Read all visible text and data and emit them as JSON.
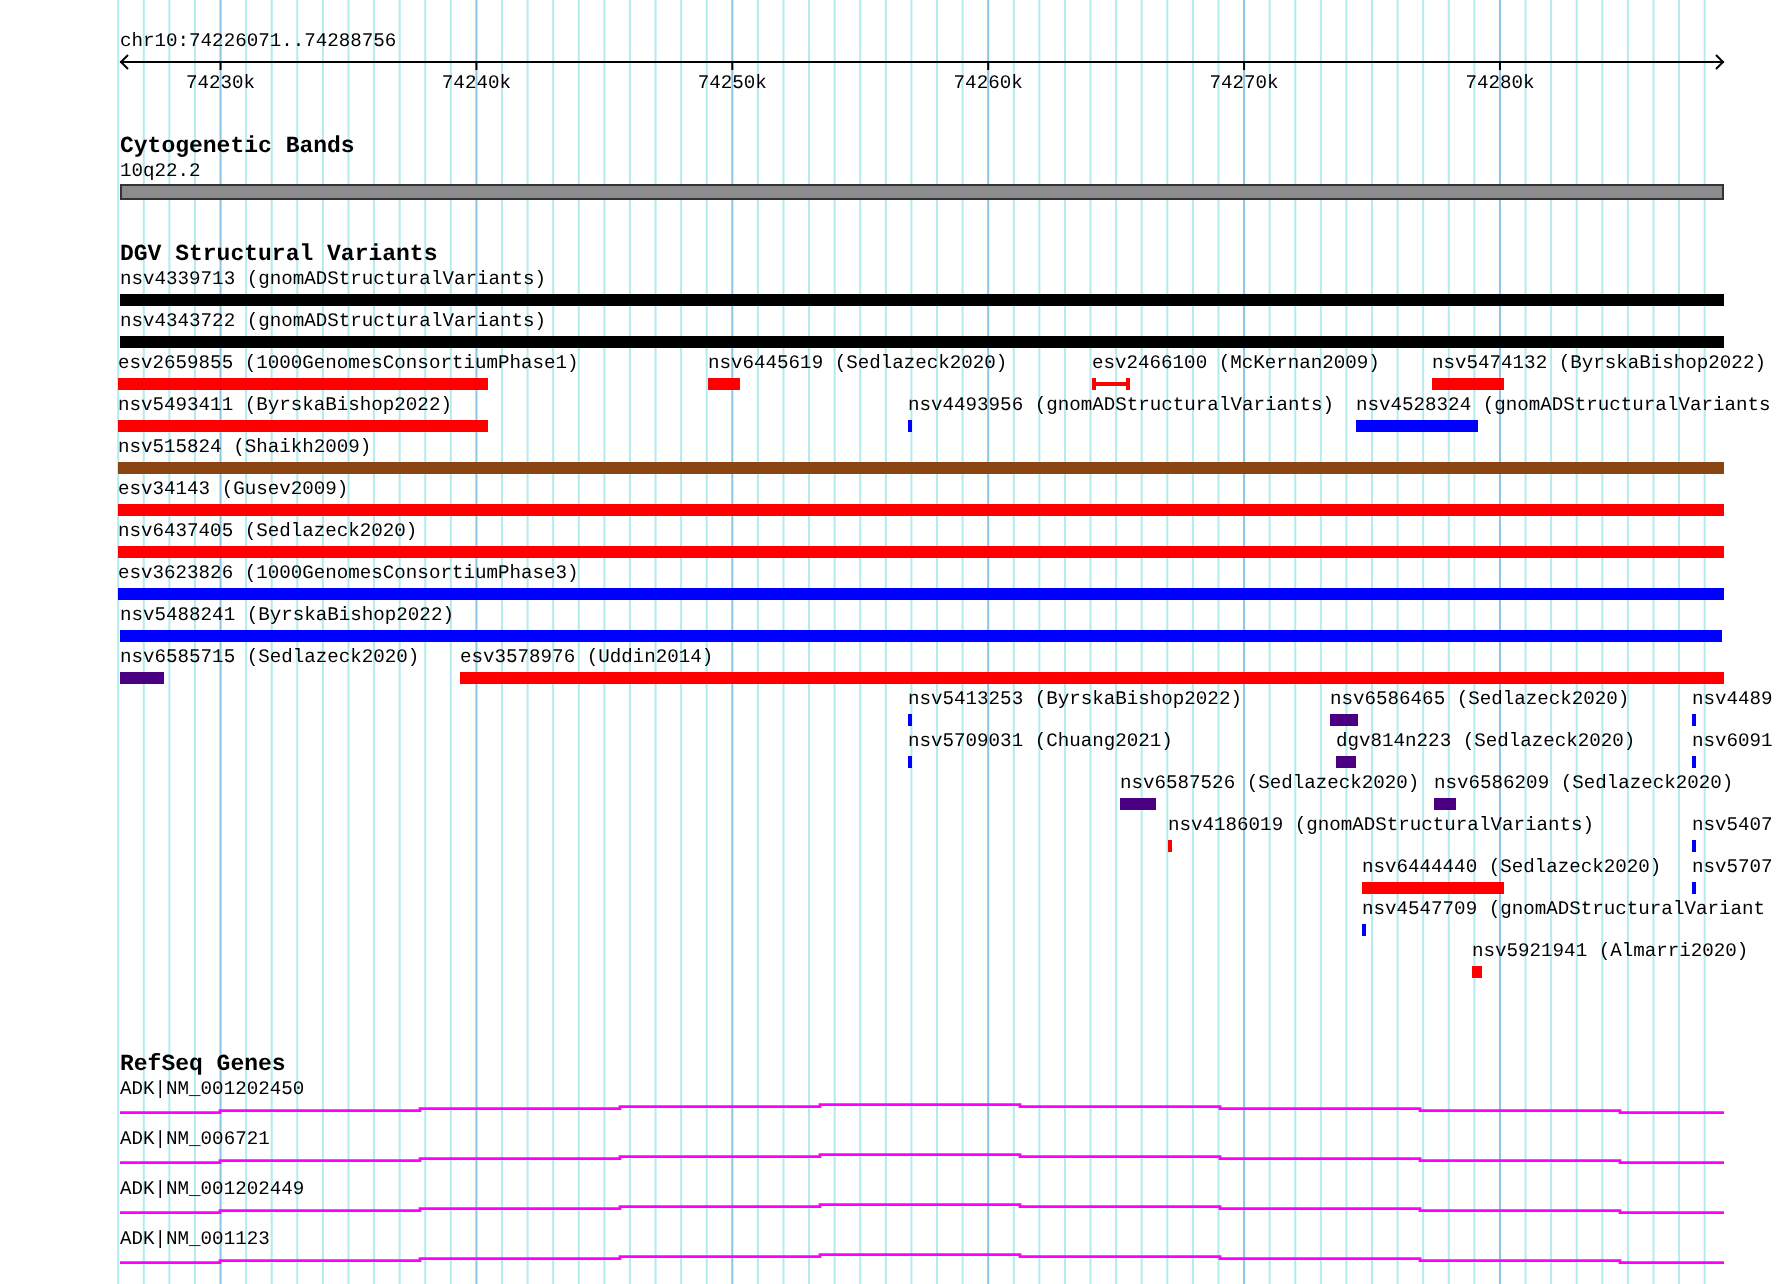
{
  "ruler": {
    "location": "chr10:74226071..74288756",
    "ticks": [
      "74230k",
      "74240k",
      "74250k",
      "74260k",
      "74270k",
      "74280k"
    ]
  },
  "tracks": [
    {
      "kind": "cytoband",
      "title": "Cytogenetic Bands",
      "bands": [
        {
          "label": "10q22.2"
        }
      ]
    },
    {
      "kind": "variants",
      "title": "DGV Structural Variants",
      "rows": [
        {
          "features": [
            {
              "label": "nsv4339713 (gnomADStructuralVariants)",
              "color": "#000000",
              "kind": "bar"
            }
          ]
        },
        {
          "features": [
            {
              "label": "nsv4343722 (gnomADStructuralVariants)",
              "color": "#000000",
              "kind": "bar"
            }
          ]
        },
        {
          "features": [
            {
              "label": "esv2659855 (1000GenomesConsortiumPhase1)",
              "color": "#ff0000",
              "kind": "bar"
            },
            {
              "label": "nsv6445619 (Sedlazeck2020)",
              "color": "#ff0000",
              "kind": "bar"
            },
            {
              "label": "esv2466100 (McKernan2009)",
              "color": "#ff0000",
              "kind": "interval"
            },
            {
              "label": "nsv5474132 (ByrskaBishop2022)",
              "color": "#ff0000",
              "kind": "bar"
            }
          ]
        },
        {
          "features": [
            {
              "label": "nsv5493411 (ByrskaBishop2022)",
              "color": "#ff0000",
              "kind": "bar"
            },
            {
              "label": "nsv4493956 (gnomADStructuralVariants)",
              "color": "#0000ff",
              "kind": "bar"
            },
            {
              "label": "nsv4528324 (gnomADStructuralVariants",
              "color": "#0000ff",
              "kind": "bar"
            }
          ]
        },
        {
          "features": [
            {
              "label": "nsv515824 (Shaikh2009)",
              "color": "#8b4513",
              "kind": "bar"
            }
          ]
        },
        {
          "features": [
            {
              "label": "esv34143 (Gusev2009)",
              "color": "#ff0000",
              "kind": "bar"
            }
          ]
        },
        {
          "features": [
            {
              "label": "nsv6437405 (Sedlazeck2020)",
              "color": "#ff0000",
              "kind": "bar"
            }
          ]
        },
        {
          "features": [
            {
              "label": "esv3623826 (1000GenomesConsortiumPhase3)",
              "color": "#0000ff",
              "kind": "bar"
            }
          ]
        },
        {
          "features": [
            {
              "label": "nsv5488241 (ByrskaBishop2022)",
              "color": "#0000ff",
              "kind": "bar"
            }
          ]
        },
        {
          "features": [
            {
              "label": "nsv6585715 (Sedlazeck2020)",
              "color": "#4b0082",
              "kind": "bar"
            },
            {
              "label": "esv3578976 (Uddin2014)",
              "color": "#ff0000",
              "kind": "bar"
            }
          ]
        },
        {
          "features": [
            {
              "label": "nsv5413253 (ByrskaBishop2022)",
              "color": "#0000ff",
              "kind": "bar"
            },
            {
              "label": "nsv6586465 (Sedlazeck2020)",
              "color": "#4b0082",
              "kind": "bar"
            },
            {
              "label": "nsv4489",
              "color": "#0000ff",
              "kind": "bar"
            }
          ]
        },
        {
          "features": [
            {
              "label": "nsv5709031 (Chuang2021)",
              "color": "#0000ff",
              "kind": "bar"
            },
            {
              "label": "dgv814n223 (Sedlazeck2020)",
              "color": "#4b0082",
              "kind": "bar"
            },
            {
              "label": "nsv6091",
              "color": "#0000ff",
              "kind": "bar"
            }
          ]
        },
        {
          "features": [
            {
              "label": "nsv6587526 (Sedlazeck2020)",
              "color": "#4b0082",
              "kind": "bar"
            },
            {
              "label": "nsv6586209 (Sedlazeck2020)",
              "color": "#4b0082",
              "kind": "bar"
            }
          ]
        },
        {
          "features": [
            {
              "label": "nsv4186019 (gnomADStructuralVariants)",
              "color": "#ff0000",
              "kind": "bar"
            },
            {
              "label": "nsv5407",
              "color": "#0000ff",
              "kind": "bar"
            }
          ]
        },
        {
          "features": [
            {
              "label": "nsv6444440 (Sedlazeck2020)",
              "color": "#ff0000",
              "kind": "bar"
            },
            {
              "label": "nsv5707",
              "color": "#0000ff",
              "kind": "bar"
            }
          ]
        },
        {
          "features": [
            {
              "label": "nsv4547709 (gnomADStructuralVariant",
              "color": "#0000ff",
              "kind": "bar"
            }
          ]
        },
        {
          "features": [
            {
              "label": "nsv5921941 (Almarri2020)",
              "color": "#ff0000",
              "kind": "bar"
            }
          ]
        }
      ]
    },
    {
      "kind": "genes",
      "title": "RefSeq Genes",
      "transcripts": [
        {
          "label": "ADK|NM_001202450"
        },
        {
          "label": "ADK|NM_006721"
        },
        {
          "label": "ADK|NM_001202449"
        },
        {
          "label": "ADK|NM_001123"
        }
      ]
    }
  ]
}
